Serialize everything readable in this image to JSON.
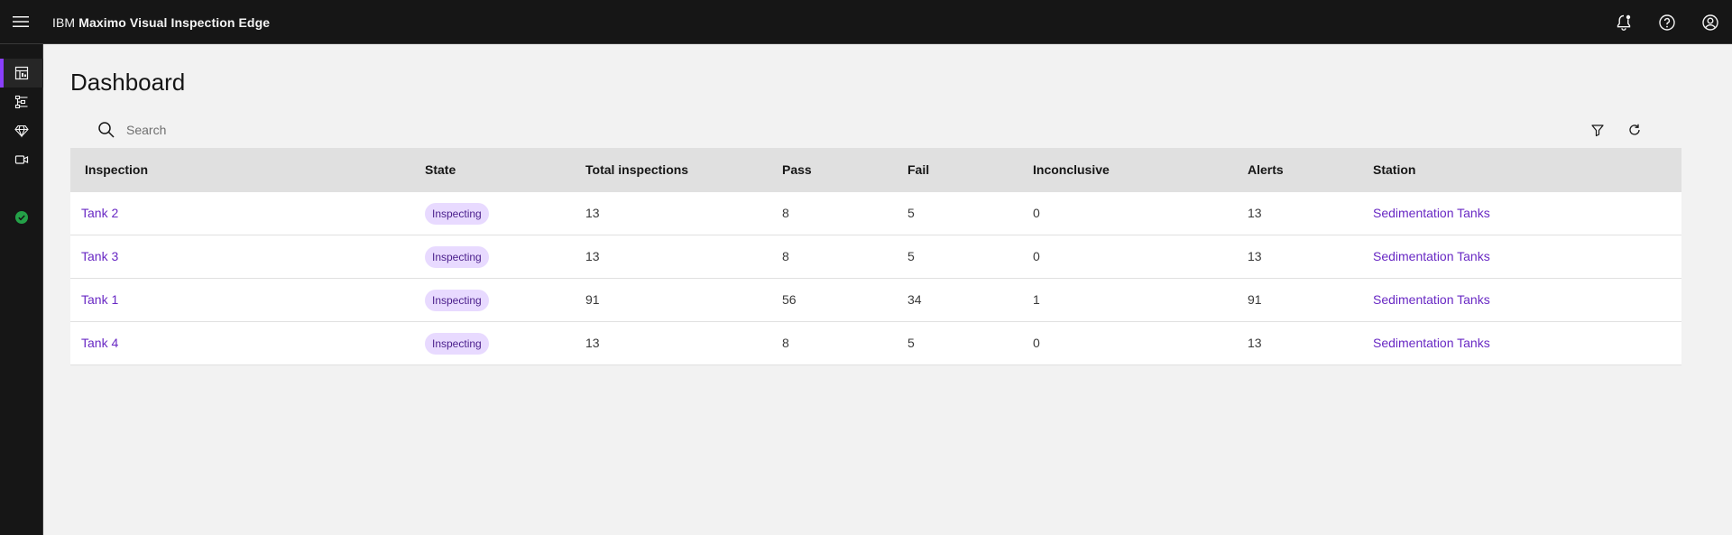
{
  "header": {
    "brand_prefix": "IBM",
    "brand_name": "Maximo Visual Inspection Edge",
    "icons": [
      "menu-icon",
      "notification-icon",
      "help-icon",
      "user-avatar-icon"
    ]
  },
  "siderail": {
    "items": [
      {
        "icon": "dashboard-icon",
        "active": true
      },
      {
        "icon": "workflow-icon",
        "active": false
      },
      {
        "icon": "model-icon",
        "active": false
      },
      {
        "icon": "camera-icon",
        "active": false
      }
    ],
    "status_icon": "checkmark-filled-icon",
    "status_color": "#24a148"
  },
  "page": {
    "title": "Dashboard"
  },
  "toolbar": {
    "search_placeholder": "Search",
    "icons": [
      "search-icon",
      "filter-icon",
      "refresh-icon"
    ]
  },
  "table": {
    "columns": [
      "Inspection",
      "State",
      "Total inspections",
      "Pass",
      "Fail",
      "Inconclusive",
      "Alerts",
      "Station"
    ],
    "rows": [
      {
        "inspection": "Tank 2",
        "state": "Inspecting",
        "total": "13",
        "pass": "8",
        "fail": "5",
        "inconclusive": "0",
        "alerts": "13",
        "station": "Sedimentation Tanks"
      },
      {
        "inspection": "Tank 3",
        "state": "Inspecting",
        "total": "13",
        "pass": "8",
        "fail": "5",
        "inconclusive": "0",
        "alerts": "13",
        "station": "Sedimentation Tanks"
      },
      {
        "inspection": "Tank 1",
        "state": "Inspecting",
        "total": "91",
        "pass": "56",
        "fail": "34",
        "inconclusive": "1",
        "alerts": "91",
        "station": "Sedimentation Tanks"
      },
      {
        "inspection": "Tank 4",
        "state": "Inspecting",
        "total": "13",
        "pass": "8",
        "fail": "5",
        "inconclusive": "0",
        "alerts": "13",
        "station": "Sedimentation Tanks"
      }
    ]
  },
  "colors": {
    "accent": "#8a3ffc",
    "link": "#6929c4",
    "tag_bg": "#e8daff",
    "tag_text": "#491d8b",
    "header_bg": "#161616"
  }
}
